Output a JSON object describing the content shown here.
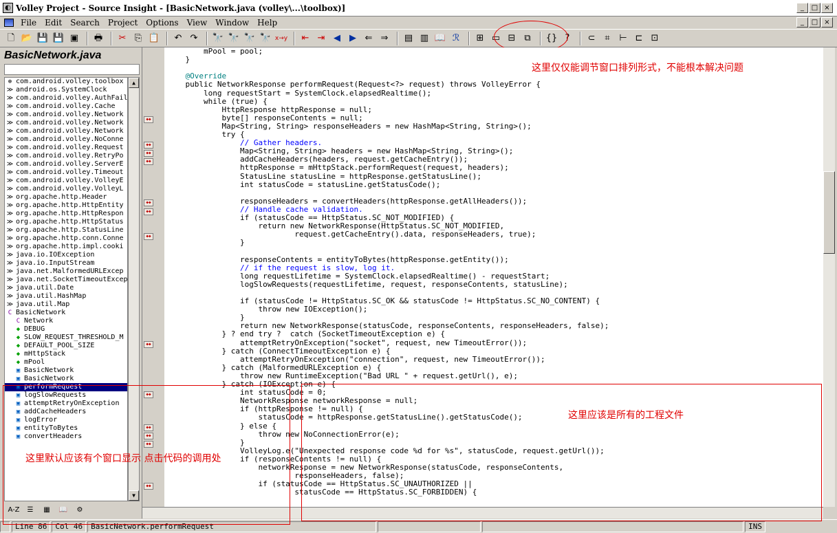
{
  "window": {
    "title": "Volley Project - Source Insight - [BasicNetwork.java (volley\\...\\toolbox)]",
    "btn_min": "_",
    "btn_max": "□",
    "btn_close": "×"
  },
  "menu": [
    "File",
    "Edit",
    "Search",
    "Project",
    "Options",
    "View",
    "Window",
    "Help"
  ],
  "sidebar": {
    "title": "BasicNetwork.java",
    "items": [
      {
        "icon": "⊕",
        "label": "com.android.volley.toolbox"
      },
      {
        "icon": "≫",
        "label": "android.os.SystemClock"
      },
      {
        "icon": "≫",
        "label": "com.android.volley.AuthFail"
      },
      {
        "icon": "≫",
        "label": "com.android.volley.Cache"
      },
      {
        "icon": "≫",
        "label": "com.android.volley.Network"
      },
      {
        "icon": "≫",
        "label": "com.android.volley.Network"
      },
      {
        "icon": "≫",
        "label": "com.android.volley.Network"
      },
      {
        "icon": "≫",
        "label": "com.android.volley.NoConne"
      },
      {
        "icon": "≫",
        "label": "com.android.volley.Request"
      },
      {
        "icon": "≫",
        "label": "com.android.volley.RetryPo"
      },
      {
        "icon": "≫",
        "label": "com.android.volley.ServerE"
      },
      {
        "icon": "≫",
        "label": "com.android.volley.Timeout"
      },
      {
        "icon": "≫",
        "label": "com.android.volley.VolleyE"
      },
      {
        "icon": "≫",
        "label": "com.android.volley.VolleyL"
      },
      {
        "icon": "≫",
        "label": "org.apache.http.Header"
      },
      {
        "icon": "≫",
        "label": "org.apache.http.HttpEntity"
      },
      {
        "icon": "≫",
        "label": "org.apache.http.HttpRespon"
      },
      {
        "icon": "≫",
        "label": "org.apache.http.HttpStatus"
      },
      {
        "icon": "≫",
        "label": "org.apache.http.StatusLine"
      },
      {
        "icon": "≫",
        "label": "org.apache.http.conn.Conne"
      },
      {
        "icon": "≫",
        "label": "org.apache.http.impl.cooki"
      },
      {
        "icon": "≫",
        "label": "java.io.IOException"
      },
      {
        "icon": "≫",
        "label": "java.io.InputStream"
      },
      {
        "icon": "≫",
        "label": "java.net.MalformedURLExcep"
      },
      {
        "icon": "≫",
        "label": "java.net.SocketTimeoutExcep"
      },
      {
        "icon": "≫",
        "label": "java.util.Date"
      },
      {
        "icon": "≫",
        "label": "java.util.HashMap"
      },
      {
        "icon": "≫",
        "label": "java.util.Map"
      },
      {
        "icon": "C",
        "label": "BasicNetwork"
      },
      {
        "icon": "C",
        "label": "Network"
      },
      {
        "icon": "◆",
        "label": "DEBUG"
      },
      {
        "icon": "◆",
        "label": "SLOW_REQUEST_THRESHOLD_M"
      },
      {
        "icon": "◆",
        "label": "DEFAULT_POOL_SIZE"
      },
      {
        "icon": "◆",
        "label": "mHttpStack"
      },
      {
        "icon": "◆",
        "label": "mPool"
      },
      {
        "icon": "▣",
        "label": "BasicNetwork"
      },
      {
        "icon": "▣",
        "label": "BasicNetwork"
      },
      {
        "icon": "▣",
        "label": "performRequest"
      },
      {
        "icon": "▣",
        "label": "logSlowRequests"
      },
      {
        "icon": "▣",
        "label": "attemptRetryOnException"
      },
      {
        "icon": "▣",
        "label": "addCacheHeaders"
      },
      {
        "icon": "▣",
        "label": "logError"
      },
      {
        "icon": "▣",
        "label": "entityToBytes"
      },
      {
        "icon": "▣",
        "label": "convertHeaders"
      }
    ]
  },
  "code": [
    "        mPool = pool;",
    "    }",
    "",
    "    @Override",
    "    public NetworkResponse performRequest(Request<?> request) throws VolleyError {",
    "        long requestStart = SystemClock.elapsedRealtime();",
    "        while (true) {",
    "            HttpResponse httpResponse = null;",
    "            byte[] responseContents = null;",
    "            Map<String, String> responseHeaders = new HashMap<String, String>();",
    "            try {",
    "                // Gather headers.",
    "                Map<String, String> headers = new HashMap<String, String>();",
    "                addCacheHeaders(headers, request.getCacheEntry());",
    "                httpResponse = mHttpStack.performRequest(request, headers);",
    "                StatusLine statusLine = httpResponse.getStatusLine();",
    "                int statusCode = statusLine.getStatusCode();",
    "",
    "                responseHeaders = convertHeaders(httpResponse.getAllHeaders());",
    "                // Handle cache validation.",
    "                if (statusCode == HttpStatus.SC_NOT_MODIFIED) {",
    "                    return new NetworkResponse(HttpStatus.SC_NOT_MODIFIED,",
    "                            request.getCacheEntry().data, responseHeaders, true);",
    "                }",
    "",
    "                responseContents = entityToBytes(httpResponse.getEntity());",
    "                // if the request is slow, log it.",
    "                long requestLifetime = SystemClock.elapsedRealtime() - requestStart;",
    "                logSlowRequests(requestLifetime, request, responseContents, statusLine);",
    "",
    "                if (statusCode != HttpStatus.SC_OK && statusCode != HttpStatus.SC_NO_CONTENT) {",
    "                    throw new IOException();",
    "                }",
    "                return new NetworkResponse(statusCode, responseContents, responseHeaders, false);",
    "            } ? end try ?  catch (SocketTimeoutException e) {",
    "                attemptRetryOnException(\"socket\", request, new TimeoutError());",
    "            } catch (ConnectTimeoutException e) {",
    "                attemptRetryOnException(\"connection\", request, new TimeoutError());",
    "            } catch (MalformedURLException e) {",
    "                throw new RuntimeException(\"Bad URL \" + request.getUrl(), e);",
    "            } catch (IOException e) {",
    "                int statusCode = 0;",
    "                NetworkResponse networkResponse = null;",
    "                if (httpResponse != null) {",
    "                    statusCode = httpResponse.getStatusLine().getStatusCode();",
    "                } else {",
    "                    throw new NoConnectionError(e);",
    "                }",
    "                VolleyLog.e(\"Unexpected response code %d for %s\", statusCode, request.getUrl());",
    "                if (responseContents != null) {",
    "                    networkResponse = new NetworkResponse(statusCode, responseContents,",
    "                            responseHeaders, false);",
    "                    if (statusCode == HttpStatus.SC_UNAUTHORIZED ||",
    "                            statusCode == HttpStatus.SC_FORBIDDEN) {"
  ],
  "status": {
    "line": "Line 86",
    "col": "Col 46",
    "symbol": "BasicNetwork.performRequest",
    "mode": "INS"
  },
  "annotations": {
    "top_right": "这里仅仅能调节窗口排列形式，不能根本解决问题",
    "middle_right": "这里应该是所有的工程文件",
    "bottom_left": "这里默认应该有个窗口显示 点击代码的调用处"
  }
}
